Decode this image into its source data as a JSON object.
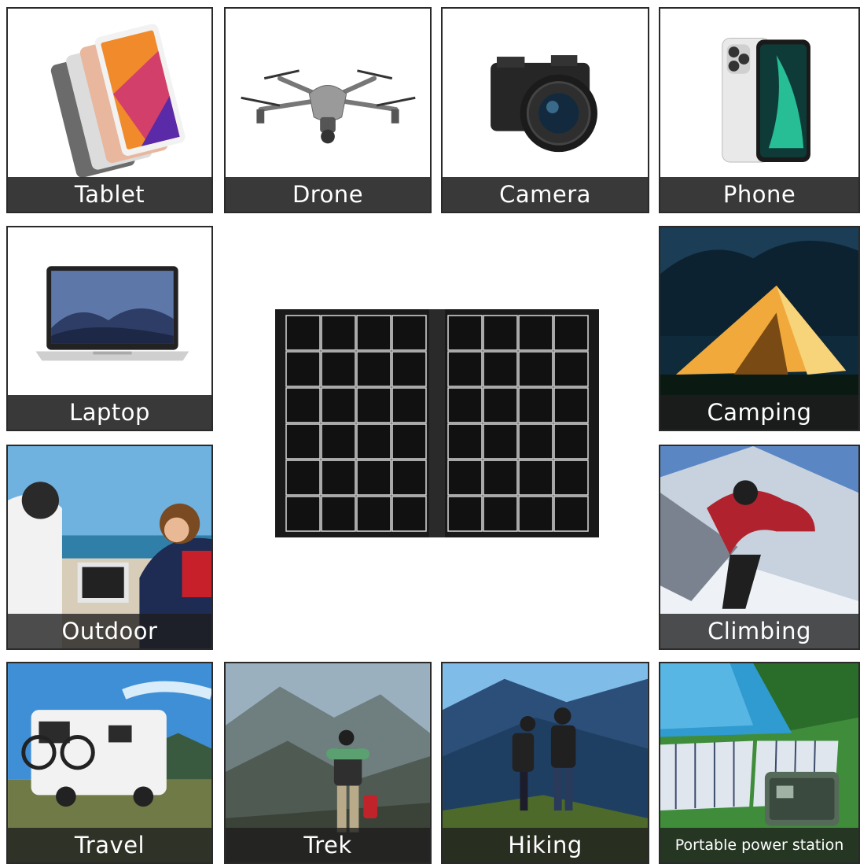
{
  "tiles": [
    {
      "id": "tablet",
      "label": "Tablet"
    },
    {
      "id": "drone",
      "label": "Drone"
    },
    {
      "id": "camera",
      "label": "Camera"
    },
    {
      "id": "phone",
      "label": "Phone"
    },
    {
      "id": "laptop",
      "label": "Laptop"
    },
    {
      "id": "camping",
      "label": "Camping"
    },
    {
      "id": "outdoor",
      "label": "Outdoor"
    },
    {
      "id": "climbing",
      "label": "Climbing"
    },
    {
      "id": "travel",
      "label": "Travel"
    },
    {
      "id": "trek",
      "label": "Trek"
    },
    {
      "id": "hiking",
      "label": "Hiking"
    },
    {
      "id": "power-station",
      "label": "Portable power station"
    }
  ],
  "colors": {
    "label_bg": "#2b2b2b",
    "label_text": "#ffffff",
    "panel_frame": "#1a1a1a"
  }
}
